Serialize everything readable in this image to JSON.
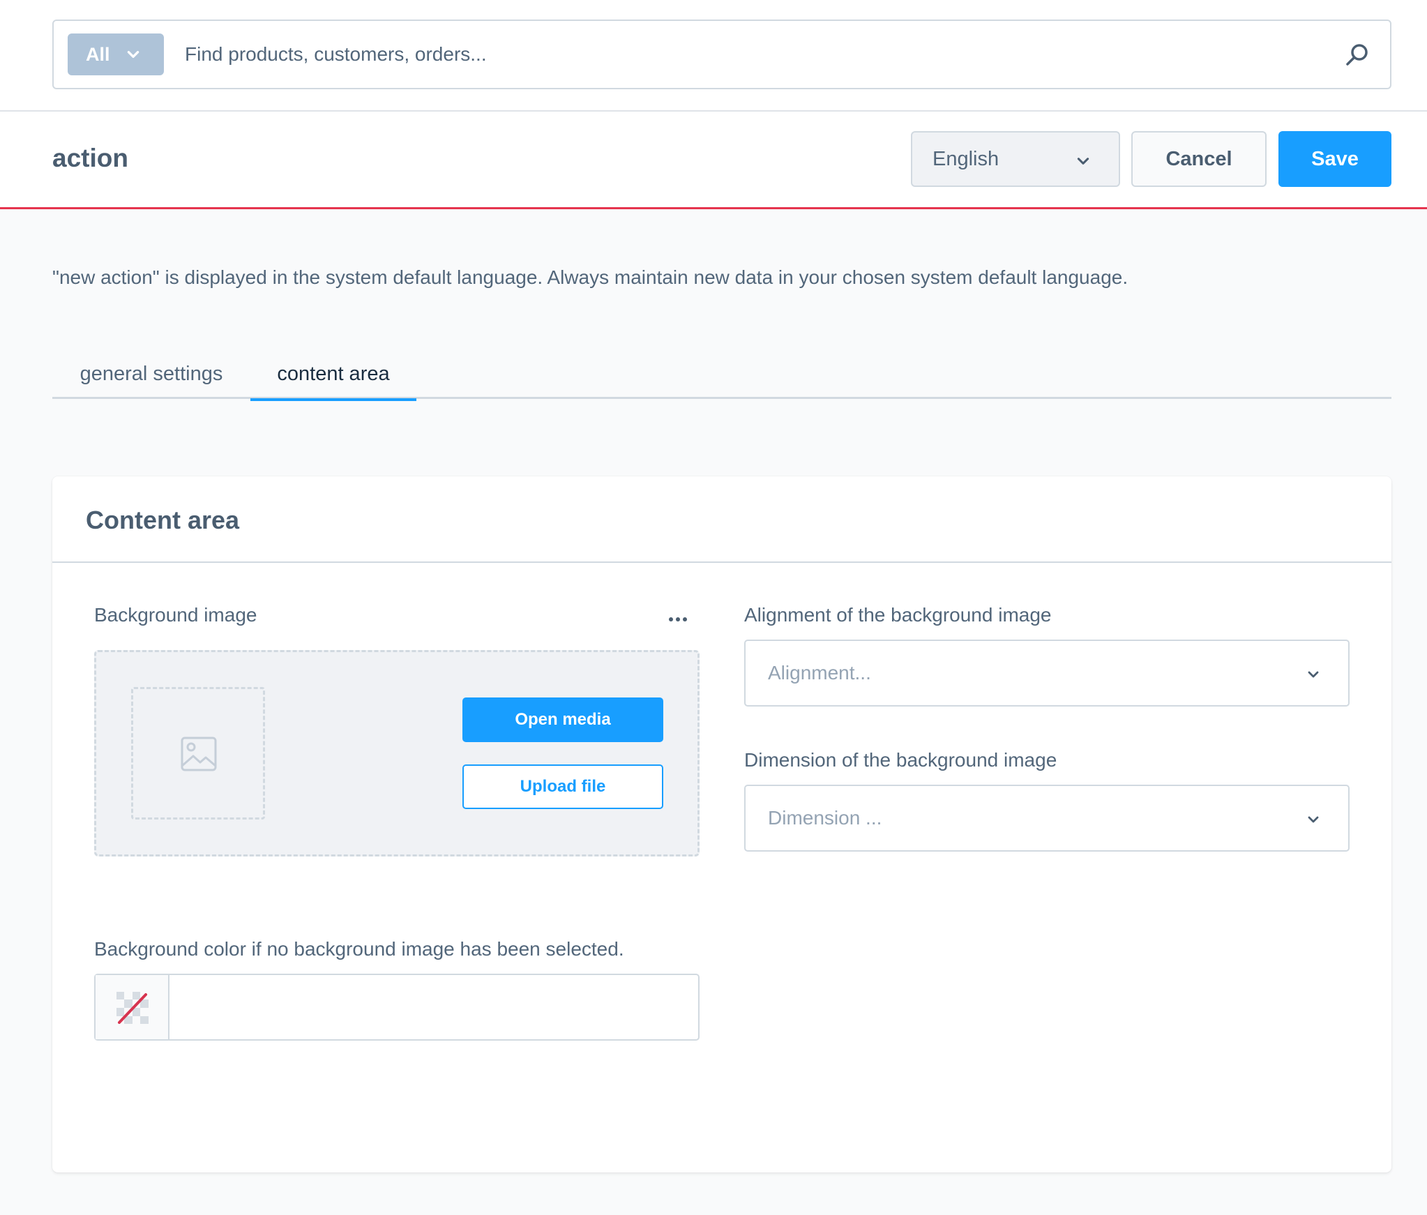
{
  "search": {
    "type_label": "All",
    "placeholder": "Find products, customers, orders...",
    "value": ""
  },
  "header": {
    "title": "action",
    "language": "English",
    "cancel_label": "Cancel",
    "save_label": "Save"
  },
  "info": {
    "message": "\"new action\" is displayed in the system default language. Always maintain new data in your chosen system default language."
  },
  "tabs": [
    {
      "label": "general settings",
      "active": false
    },
    {
      "label": "content area",
      "active": true
    }
  ],
  "card": {
    "title": "Content area",
    "background_image": {
      "label": "Background image",
      "open_media_label": "Open media",
      "upload_label": "Upload file"
    },
    "alignment": {
      "label": "Alignment of the background image",
      "placeholder": "Alignment..."
    },
    "dimension": {
      "label": "Dimension of the background image",
      "placeholder": "Dimension ..."
    },
    "background_color": {
      "label": "Background color if no background image has been selected.",
      "value": ""
    }
  },
  "colors": {
    "accent": "#189eff",
    "header_border": "#e5344e",
    "search_type_bg": "#aec3d8"
  }
}
